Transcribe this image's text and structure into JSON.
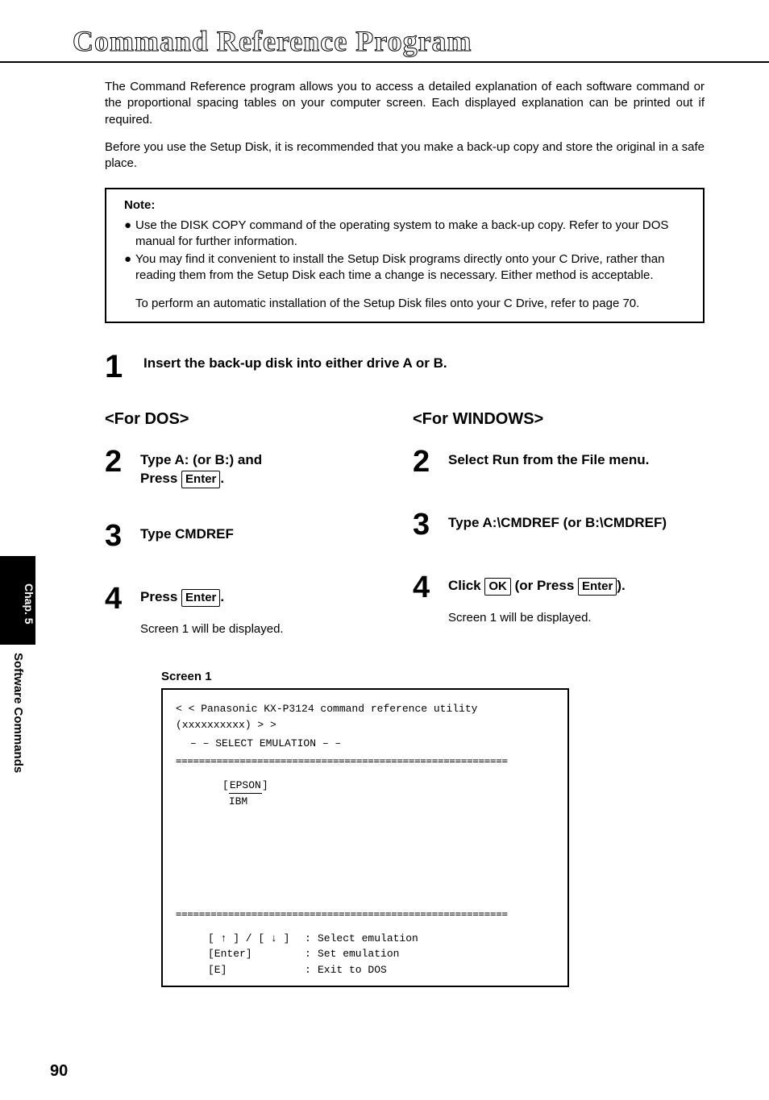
{
  "title": "Command Reference Program",
  "intro1": "The Command Reference program allows you to access a detailed explanation of each software command or the proportional spacing tables on your computer screen. Each displayed explanation can be printed out if required.",
  "intro2": "Before you use the Setup Disk, it is recommended that you make a back-up copy and store the original in a safe place.",
  "note": {
    "head": "Note:",
    "b1": "Use the DISK COPY command of the operating system to make a back-up copy. Refer to your DOS manual for further information.",
    "b2": "You may find it convenient to install the Setup Disk programs directly onto your C Drive, rather than reading them from the Setup Disk each time a change is necessary. Either method is acceptable.",
    "foot": "To perform an automatic installation of the Setup Disk files onto your C Drive, refer to page 70."
  },
  "step1": "Insert the back-up disk into either drive A or B.",
  "dos": {
    "head": "<For DOS>",
    "s2a": "Type A: (or B:) and",
    "s2b": "Press ",
    "s3": "Type CMDREF",
    "s4a": "Press ",
    "s4sub": "Screen 1 will be displayed."
  },
  "win": {
    "head": "<For WINDOWS>",
    "s2": "Select Run from the File menu.",
    "s3": "Type A:\\CMDREF (or  B:\\CMDREF)",
    "s4a": "Click ",
    "s4b": " (or Press ",
    "s4c": ").",
    "s4sub": "Screen 1 will be displayed."
  },
  "key_enter": "Enter",
  "key_ok": "OK",
  "screen": {
    "label": "Screen 1",
    "hdr": "< <   Panasonic KX-P3124 command reference utility (xxxxxxxxxx)   > >",
    "subhdr": "– –  SELECT EMULATION – –",
    "opt1": "EPSON",
    "opt2": "IBM",
    "k1": "[ ↑ ] / [ ↓ ]",
    "k2": "[Enter]",
    "k3": "[E]",
    "d1": "Select emulation",
    "d2": "Set emulation",
    "d3": "Exit to DOS"
  },
  "side_tab": "Chap. 5",
  "side_label": "Software Commands",
  "page_num": "90"
}
